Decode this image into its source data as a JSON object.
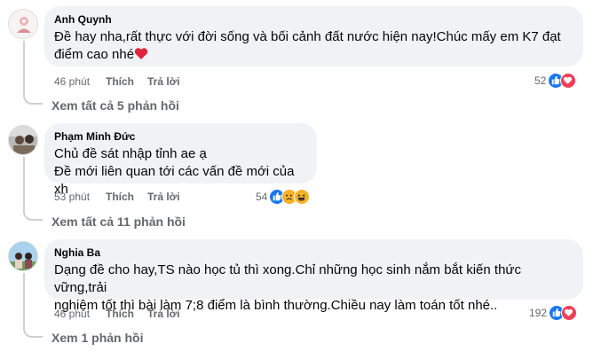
{
  "comments": [
    {
      "author": "Anh Quynh",
      "lines": [
        "Đề hay nha,rất thực với đời sống và bối cảnh đất nước hiện nay!Chúc mấy em K7 đạt",
        "điểm cao nhé"
      ],
      "time": "46 phút",
      "like_label": "Thích",
      "reply_label": "Trả lời",
      "reaction_count": "52",
      "reaction_icons": [
        "like-icon",
        "love-icon"
      ],
      "view_replies": "Xem tất cả 5 phản hồi"
    },
    {
      "author": "Phạm Minh Đức",
      "lines": [
        "Chủ đề sát nhập tỉnh ae ạ",
        "Đề mới liên quan tới các vấn đề mới của xh"
      ],
      "time": "53 phút",
      "like_label": "Thích",
      "reply_label": "Trả lời",
      "reaction_count": "54",
      "reaction_icons": [
        "like-icon",
        "sad-icon",
        "haha-icon"
      ],
      "view_replies": "Xem tất cả 11 phản hồi"
    },
    {
      "author": "Nghia Ba",
      "lines": [
        "Dạng đề cho hay,TS nào học tủ thì xong.Chỉ những học sinh nắm bắt kiến thức vững,trải",
        "nghiệm tốt thì bài làm 7;8 điểm là bình thường.Chiều nay làm toán tốt nhé.."
      ],
      "time": "46 phút",
      "like_label": "Thích",
      "reply_label": "Trả lời",
      "reaction_count": "192",
      "reaction_icons": [
        "like-icon",
        "love-icon"
      ],
      "view_replies": "Xem 1 phản hồi"
    }
  ],
  "colors": {
    "bubble": "#f0f2f5",
    "secondary_text": "#65676b",
    "like_blue": "#1877f2",
    "love_red": "#f33e58",
    "emoji_yellow": "#f7b125"
  }
}
